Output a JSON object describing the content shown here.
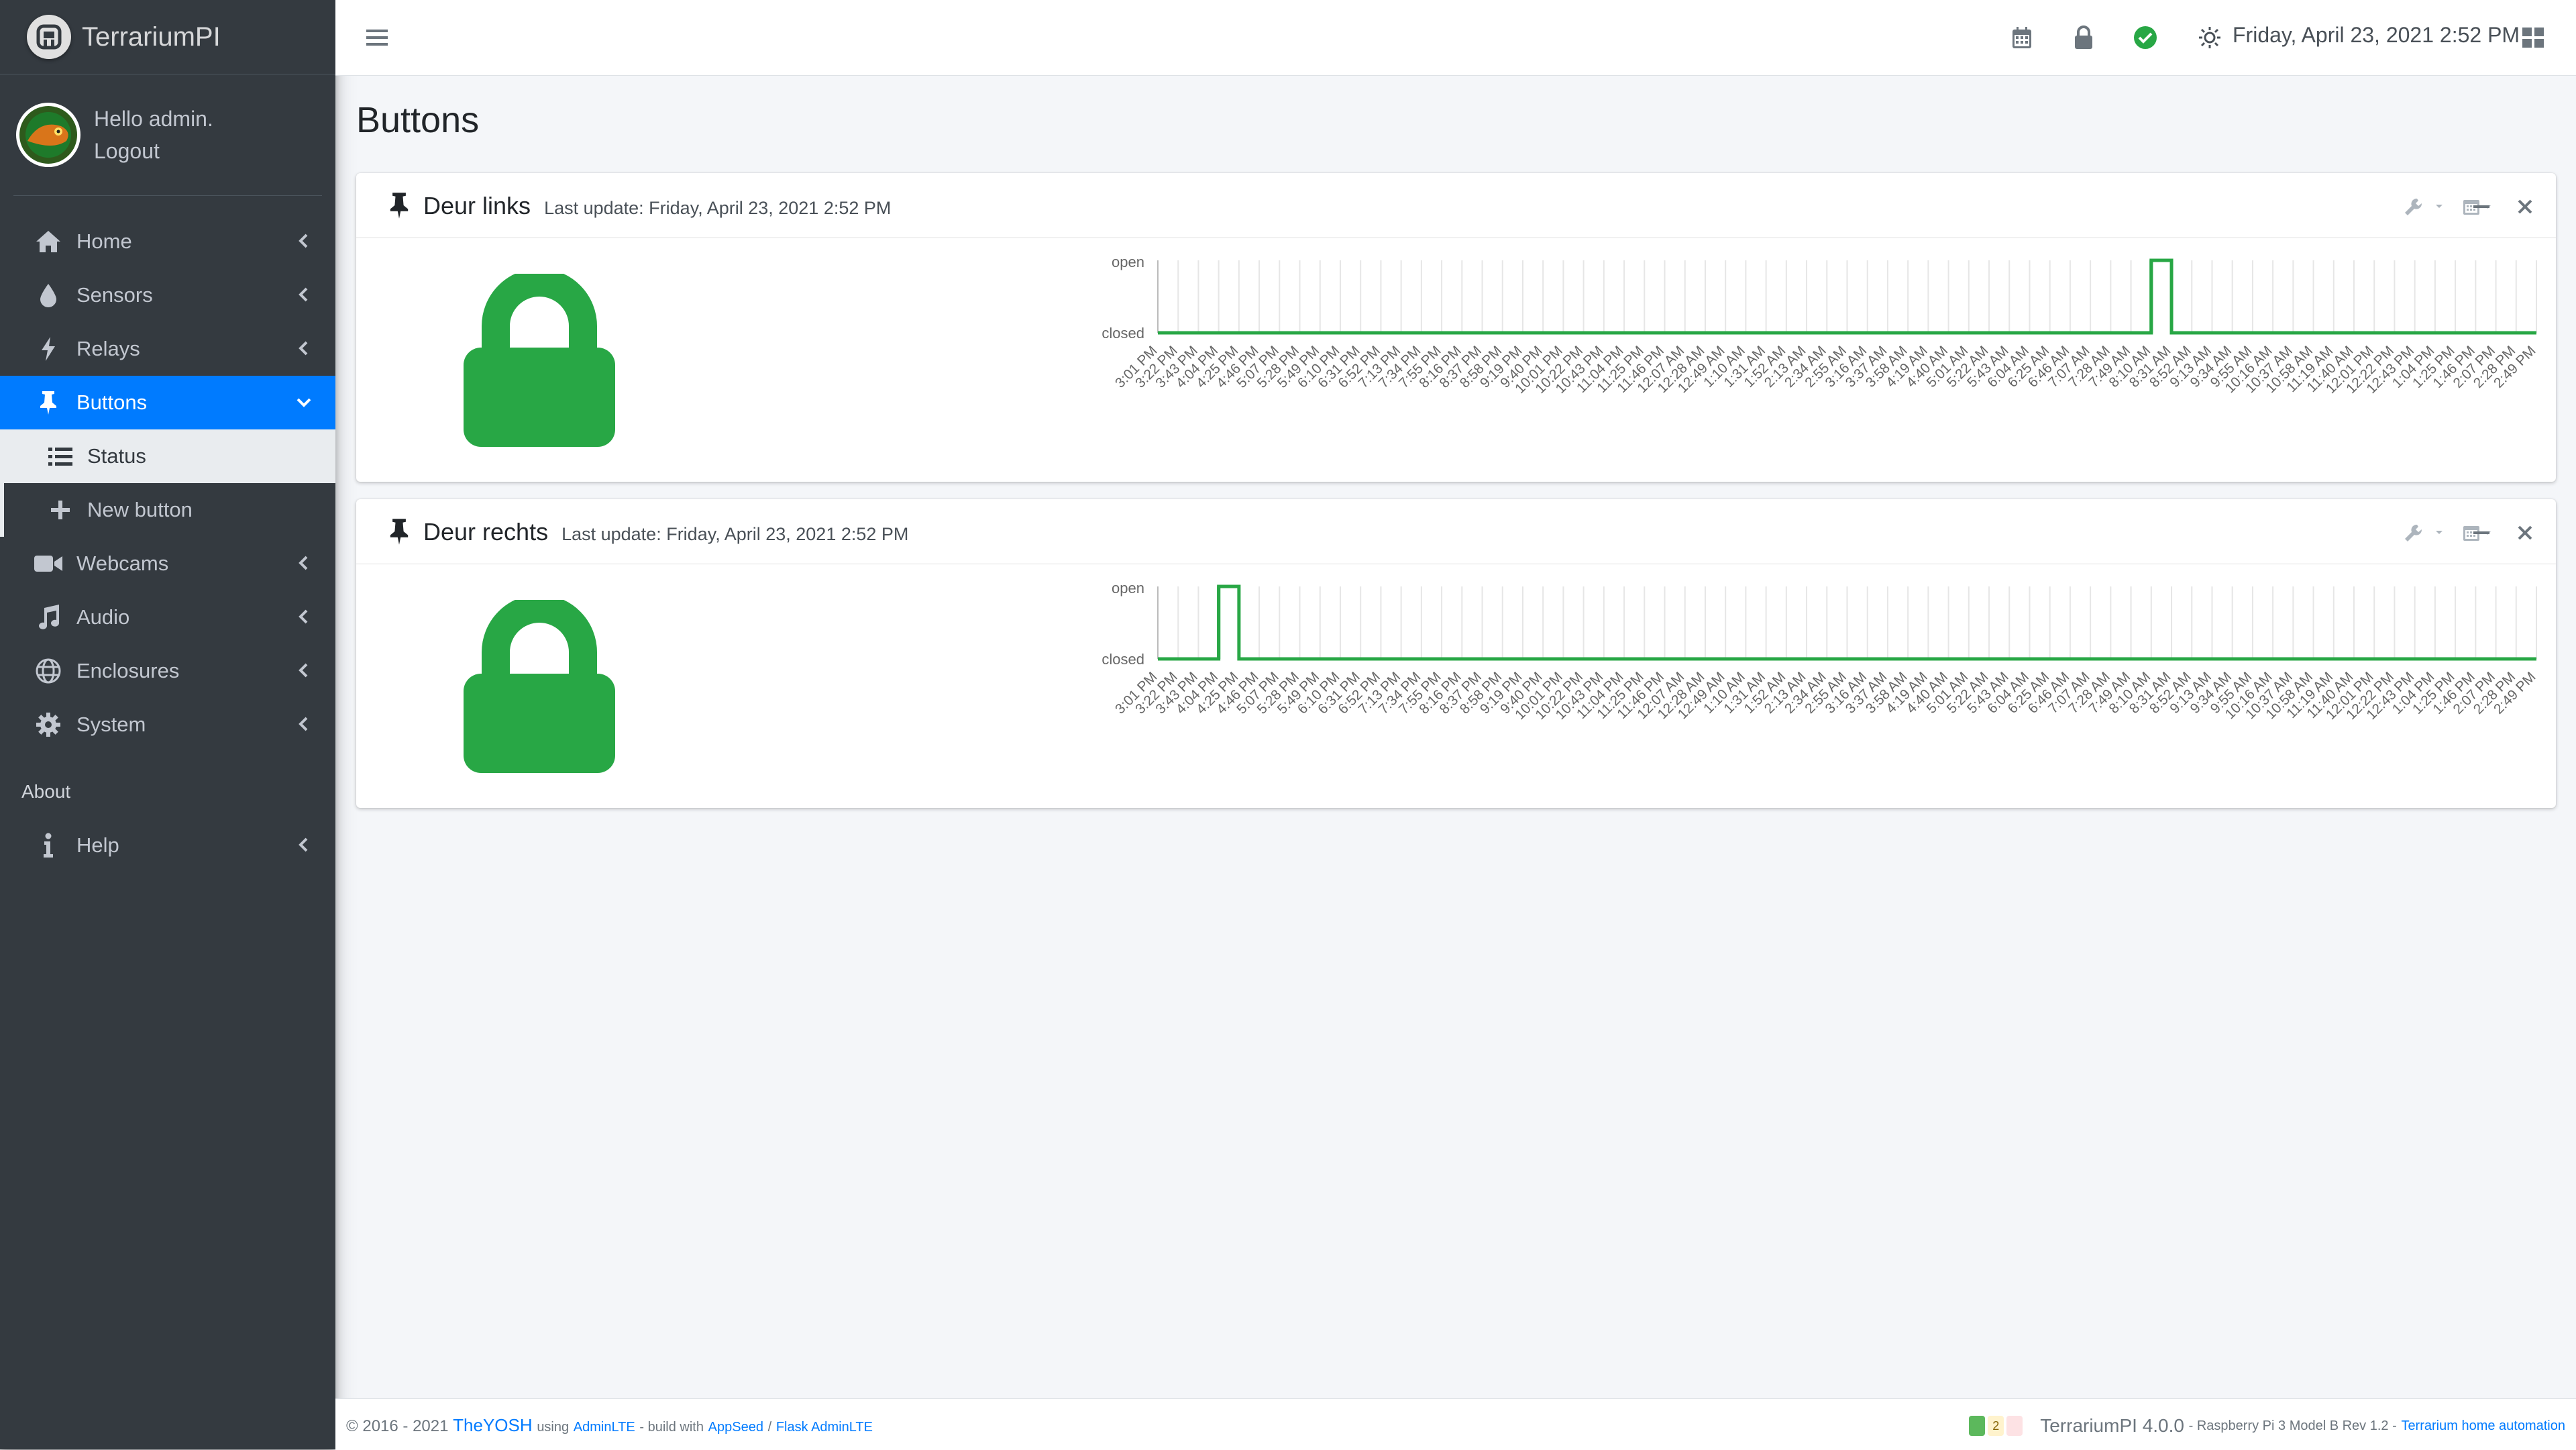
{
  "brand": {
    "name": "TerrariumPI"
  },
  "user": {
    "greeting": "Hello admin.",
    "logout": "Logout"
  },
  "sidebar": {
    "items": [
      {
        "label": "Home",
        "icon": "home-icon"
      },
      {
        "label": "Sensors",
        "icon": "tint-icon"
      },
      {
        "label": "Relays",
        "icon": "bolt-icon"
      },
      {
        "label": "Buttons",
        "icon": "thumbtack-icon",
        "active": true
      },
      {
        "label": "Webcams",
        "icon": "video-icon"
      },
      {
        "label": "Audio",
        "icon": "music-icon"
      },
      {
        "label": "Enclosures",
        "icon": "globe-icon"
      },
      {
        "label": "System",
        "icon": "gear-icon"
      }
    ],
    "subitems": [
      {
        "label": "Status",
        "icon": "list-icon"
      },
      {
        "label": "New button",
        "icon": "plus-icon"
      }
    ],
    "about_header": "About",
    "help": {
      "label": "Help",
      "icon": "info-icon"
    }
  },
  "topbar": {
    "datetime": "Friday, April 23, 2021 2:52 PM"
  },
  "page": {
    "title": "Buttons"
  },
  "cards": [
    {
      "title": "Deur links",
      "last_update": "Last update: Friday, April 23, 2021 2:52 PM",
      "state": "closed",
      "state_color": "#28a745"
    },
    {
      "title": "Deur rechts",
      "last_update": "Last update: Friday, April 23, 2021 2:52 PM",
      "state": "closed",
      "state_color": "#28a745"
    }
  ],
  "chart_data": [
    {
      "type": "line",
      "title": "",
      "y_categories": [
        "closed",
        "open"
      ],
      "x": [
        "3:01 PM",
        "3:22 PM",
        "3:43 PM",
        "4:04 PM",
        "4:25 PM",
        "4:46 PM",
        "5:07 PM",
        "5:28 PM",
        "5:49 PM",
        "6:10 PM",
        "6:31 PM",
        "6:52 PM",
        "7:13 PM",
        "7:34 PM",
        "7:55 PM",
        "8:16 PM",
        "8:37 PM",
        "8:58 PM",
        "9:19 PM",
        "9:40 PM",
        "10:01 PM",
        "10:22 PM",
        "10:43 PM",
        "11:04 PM",
        "11:25 PM",
        "11:46 PM",
        "12:07 AM",
        "12:28 AM",
        "12:49 AM",
        "1:10 AM",
        "1:31 AM",
        "1:52 AM",
        "2:13 AM",
        "2:34 AM",
        "2:55 AM",
        "3:16 AM",
        "3:37 AM",
        "3:58 AM",
        "4:19 AM",
        "4:40 AM",
        "5:01 AM",
        "5:22 AM",
        "5:43 AM",
        "6:04 AM",
        "6:25 AM",
        "6:46 AM",
        "7:07 AM",
        "7:28 AM",
        "7:49 AM",
        "8:10 AM",
        "8:31 AM",
        "8:52 AM",
        "9:13 AM",
        "9:34 AM",
        "9:55 AM",
        "10:16 AM",
        "10:37 AM",
        "10:58 AM",
        "11:19 AM",
        "11:40 AM",
        "12:01 PM",
        "12:22 PM",
        "12:43 PM",
        "1:04 PM",
        "1:25 PM",
        "1:46 PM",
        "2:07 PM",
        "2:28 PM",
        "2:49 PM"
      ],
      "series": [
        {
          "values": [
            0,
            0,
            0,
            0,
            0,
            0,
            0,
            0,
            0,
            0,
            0,
            0,
            0,
            0,
            0,
            0,
            0,
            0,
            0,
            0,
            0,
            0,
            0,
            0,
            0,
            0,
            0,
            0,
            0,
            0,
            0,
            0,
            0,
            0,
            0,
            0,
            0,
            0,
            0,
            0,
            0,
            0,
            0,
            0,
            0,
            0,
            0,
            0,
            0,
            1,
            0,
            0,
            0,
            0,
            0,
            0,
            0,
            0,
            0,
            0,
            0,
            0,
            0,
            0,
            0,
            0,
            0,
            0,
            0
          ]
        }
      ],
      "color": "#28a745",
      "grid": true
    },
    {
      "type": "line",
      "title": "",
      "y_categories": [
        "closed",
        "open"
      ],
      "x": [
        "3:01 PM",
        "3:22 PM",
        "3:43 PM",
        "4:04 PM",
        "4:25 PM",
        "4:46 PM",
        "5:07 PM",
        "5:28 PM",
        "5:49 PM",
        "6:10 PM",
        "6:31 PM",
        "6:52 PM",
        "7:13 PM",
        "7:34 PM",
        "7:55 PM",
        "8:16 PM",
        "8:37 PM",
        "8:58 PM",
        "9:19 PM",
        "9:40 PM",
        "10:01 PM",
        "10:22 PM",
        "10:43 PM",
        "11:04 PM",
        "11:25 PM",
        "11:46 PM",
        "12:07 AM",
        "12:28 AM",
        "12:49 AM",
        "1:10 AM",
        "1:31 AM",
        "1:52 AM",
        "2:13 AM",
        "2:34 AM",
        "2:55 AM",
        "3:16 AM",
        "3:37 AM",
        "3:58 AM",
        "4:19 AM",
        "4:40 AM",
        "5:01 AM",
        "5:22 AM",
        "5:43 AM",
        "6:04 AM",
        "6:25 AM",
        "6:46 AM",
        "7:07 AM",
        "7:28 AM",
        "7:49 AM",
        "8:10 AM",
        "8:31 AM",
        "8:52 AM",
        "9:13 AM",
        "9:34 AM",
        "9:55 AM",
        "10:16 AM",
        "10:37 AM",
        "10:58 AM",
        "11:19 AM",
        "11:40 AM",
        "12:01 PM",
        "12:22 PM",
        "12:43 PM",
        "1:04 PM",
        "1:25 PM",
        "1:46 PM",
        "2:07 PM",
        "2:28 PM",
        "2:49 PM"
      ],
      "series": [
        {
          "values": [
            0,
            0,
            0,
            1,
            0,
            0,
            0,
            0,
            0,
            0,
            0,
            0,
            0,
            0,
            0,
            0,
            0,
            0,
            0,
            0,
            0,
            0,
            0,
            0,
            0,
            0,
            0,
            0,
            0,
            0,
            0,
            0,
            0,
            0,
            0,
            0,
            0,
            0,
            0,
            0,
            0,
            0,
            0,
            0,
            0,
            0,
            0,
            0,
            0,
            0,
            0,
            0,
            0,
            0,
            0,
            0,
            0,
            0,
            0,
            0,
            0,
            0,
            0,
            0,
            0,
            0,
            0,
            0,
            0
          ]
        }
      ],
      "color": "#28a745",
      "grid": true
    }
  ],
  "footer": {
    "copyright": "© 2016 - 2021",
    "author": "TheYOSH",
    "using": "using",
    "adminlte": "AdminLTE",
    "build": "- build with",
    "appseed": "AppSeed",
    "slash": "/",
    "flask": "Flask AdminLTE",
    "badge_count": "2",
    "version": "TerrariumPI 4.0.0",
    "hardware": "- Raspberry Pi 3 Model B Rev 1.2 -",
    "home_link": "Terrarium home automation"
  }
}
